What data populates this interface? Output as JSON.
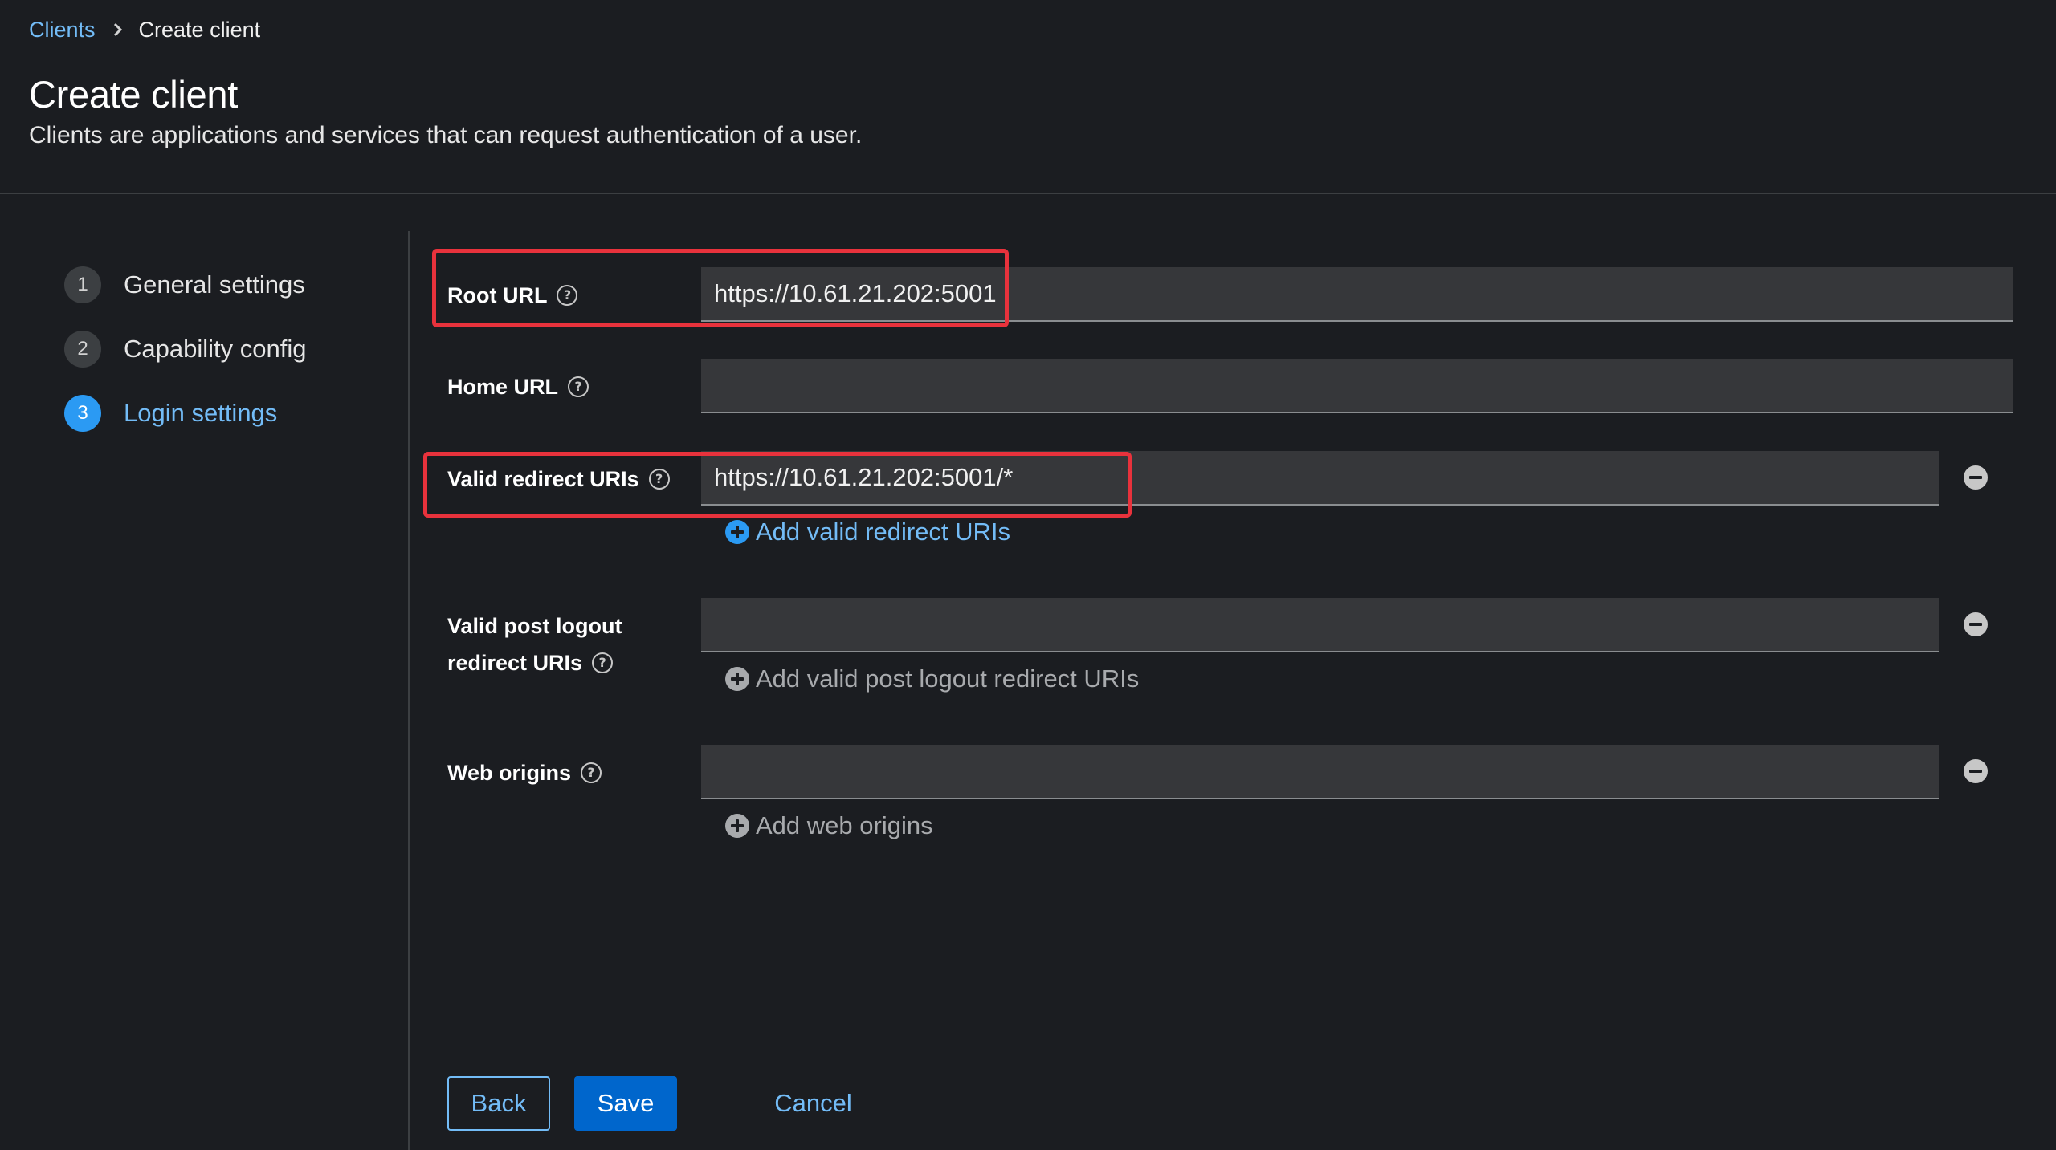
{
  "breadcrumb": {
    "parent": "Clients",
    "current": "Create client"
  },
  "header": {
    "title": "Create client",
    "description": "Clients are applications and services that can request authentication of a user."
  },
  "wizard": {
    "steps": [
      {
        "number": "1",
        "label": "General settings",
        "active": false
      },
      {
        "number": "2",
        "label": "Capability config",
        "active": false
      },
      {
        "number": "3",
        "label": "Login settings",
        "active": true
      }
    ]
  },
  "form": {
    "root_url": {
      "label": "Root URL",
      "value": "https://10.61.21.202:5001"
    },
    "home_url": {
      "label": "Home URL",
      "value": ""
    },
    "valid_redirect_uris": {
      "label": "Valid redirect URIs",
      "value": "https://10.61.21.202:5001/*",
      "add_label": "Add valid redirect URIs"
    },
    "valid_post_logout": {
      "label_line1": "Valid post logout",
      "label_line2": "redirect URIs",
      "value": "",
      "add_label": "Add valid post logout redirect URIs"
    },
    "web_origins": {
      "label": "Web origins",
      "value": "",
      "add_label": "Add web origins"
    }
  },
  "actions": {
    "back": "Back",
    "save": "Save",
    "cancel": "Cancel"
  },
  "icons": {
    "help": "help-circle-icon",
    "remove": "minus-circle-icon",
    "add": "plus-circle-icon",
    "breadcrumb_separator": "chevron-right-icon"
  },
  "colors": {
    "background": "#1b1d21",
    "link": "#73bcf7",
    "primary": "#0066cc",
    "highlight": "#e8323c",
    "input_bg": "#36373a"
  }
}
